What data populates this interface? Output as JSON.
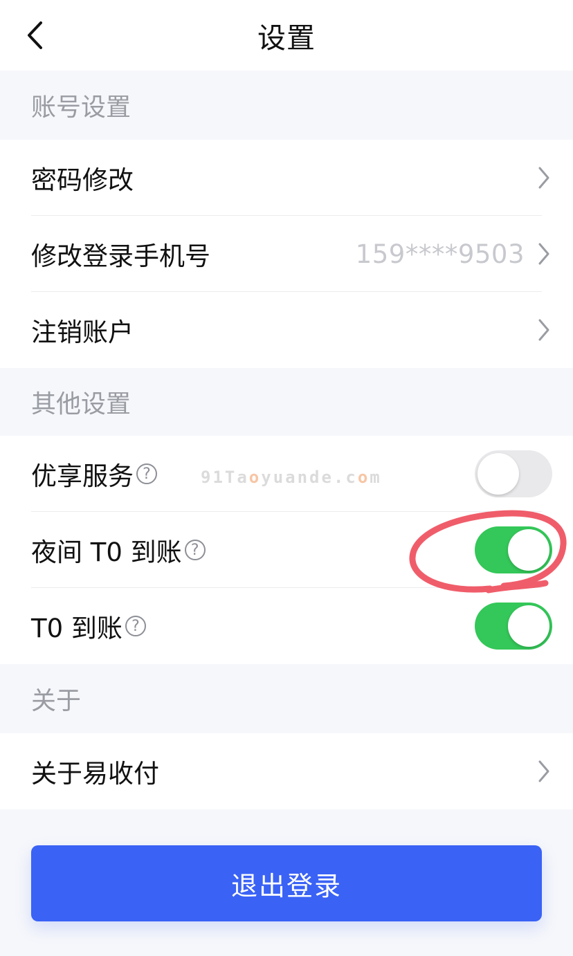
{
  "nav": {
    "title": "设置",
    "back_icon": "chevron-left-icon"
  },
  "sections": {
    "account": {
      "header": "账号设置",
      "items": [
        {
          "label": "密码修改",
          "value": ""
        },
        {
          "label": "修改登录手机号",
          "value": "159****9503"
        },
        {
          "label": "注销账户",
          "value": ""
        }
      ]
    },
    "other": {
      "header": "其他设置",
      "items": [
        {
          "label": "优享服务",
          "help": "?",
          "enabled": false
        },
        {
          "label": "夜间 T0 到账",
          "help": "?",
          "enabled": true
        },
        {
          "label": "T0 到账",
          "help": "?",
          "enabled": true
        }
      ]
    },
    "about": {
      "header": "关于",
      "items": [
        {
          "label": "关于易收付"
        }
      ]
    }
  },
  "logout_label": "退出登录",
  "watermark": {
    "prefix": "91Ta",
    "o1": "o",
    "mid": "yuande.c",
    "o2": "o",
    "suffix": "m"
  },
  "colors": {
    "accent": "#3a62f5",
    "toggle_on": "#34c759",
    "annotation": "#ee4b5a"
  }
}
